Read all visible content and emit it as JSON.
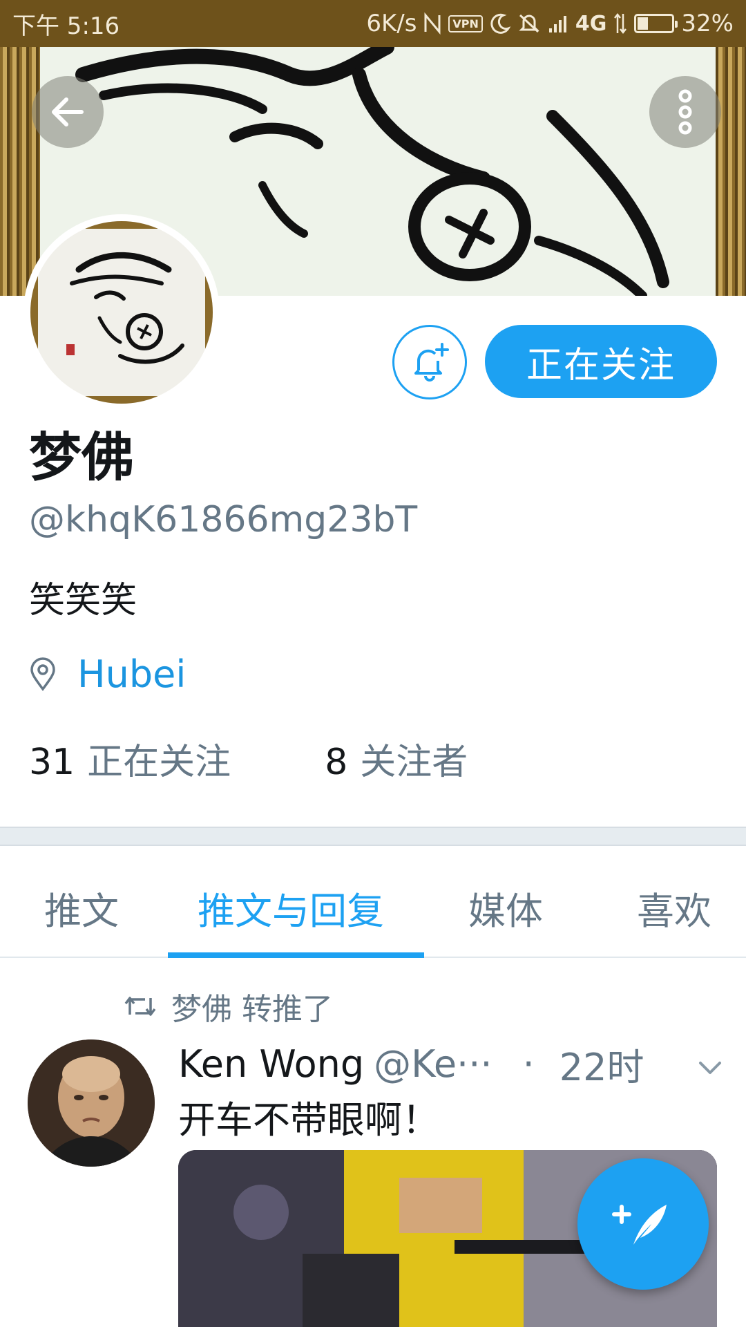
{
  "status_bar": {
    "time": "下午 5:16",
    "net_speed": "6K/s",
    "vpn": "VPN",
    "network": "4G",
    "battery": "32%",
    "battery_level": 0.32
  },
  "profile": {
    "display_name": "梦佛",
    "handle": "@khqK61866mg23bT",
    "bio": "笑笑笑",
    "location": "Hubei",
    "following_count": "31",
    "following_label": "正在关注",
    "followers_count": "8",
    "followers_label": "关注者",
    "follow_button_label": "正在关注"
  },
  "tabs": [
    {
      "label": "推文",
      "active": false
    },
    {
      "label": "推文与回复",
      "active": true
    },
    {
      "label": "媒体",
      "active": false
    },
    {
      "label": "喜欢",
      "active": false
    }
  ],
  "tweet": {
    "retweet_context": "梦佛 转推了",
    "author": "Ken Wong",
    "handle": "@Ke···",
    "separator": "·",
    "time": "22时",
    "text": "开车不带眼啊！"
  },
  "icons": {
    "back": "arrow-left-icon",
    "more": "more-vertical-icon",
    "bell": "bell-plus-icon",
    "location": "location-pin-icon",
    "retweet": "retweet-icon",
    "caret": "chevron-down-icon",
    "compose": "compose-tweet-icon"
  },
  "colors": {
    "accent": "#1da1f2",
    "status_bar": "#6e521b",
    "secondary_text": "#657786"
  }
}
